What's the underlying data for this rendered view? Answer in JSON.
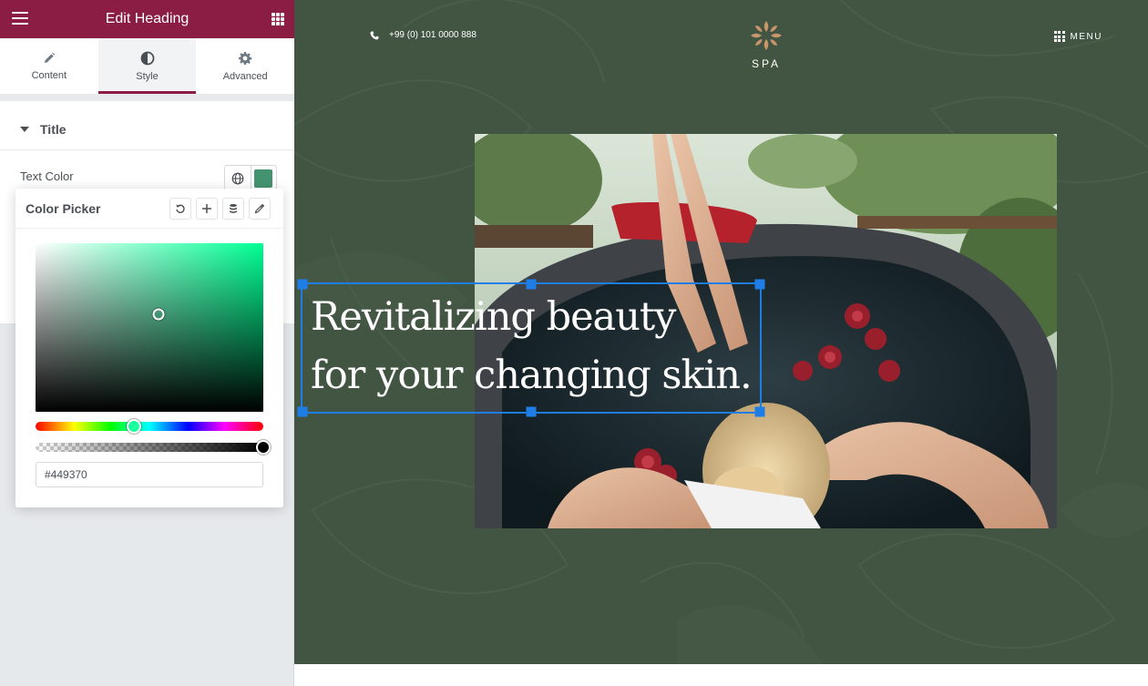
{
  "panel": {
    "title": "Edit Heading",
    "header_color": "#8b1d45",
    "tabs": [
      {
        "label": "Content",
        "icon": "pencil-icon",
        "active": false
      },
      {
        "label": "Style",
        "icon": "contrast-icon",
        "active": true
      },
      {
        "label": "Advanced",
        "icon": "gear-icon",
        "active": false
      }
    ],
    "section": {
      "label": "Title",
      "expanded": true
    },
    "control": {
      "label": "Text Color",
      "value": "#449370"
    }
  },
  "color_picker": {
    "title": "Color Picker",
    "tools": [
      "reset-icon",
      "add-icon",
      "database-icon",
      "eyedropper-icon"
    ],
    "hex_value": "#449370",
    "hue_position": 0.43,
    "saturation": 0.54,
    "brightness": 0.58,
    "alpha": 1.0
  },
  "preview": {
    "phone": "+99 (0) 101 0000 888",
    "brand": "SPA",
    "menu_label": "MENU",
    "heading_line1": "Revitalizing beauty",
    "heading_line2": "for your changing skin.",
    "background_color": "#425543",
    "accent_logo_color": "#c9956b",
    "selection_color": "#1e7ee6"
  }
}
